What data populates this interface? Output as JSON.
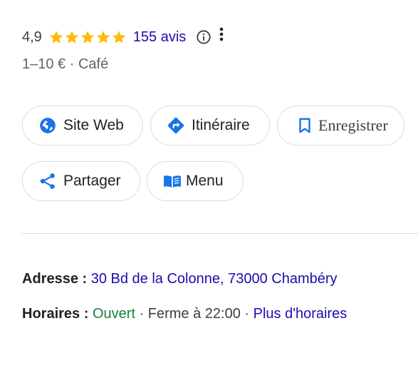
{
  "rating": {
    "value": "4,9",
    "stars_filled": 5,
    "star_color": "#fbbc04",
    "reviews_label": "155 avis"
  },
  "meta": {
    "text": "1–10 € · Café"
  },
  "actions": [
    {
      "label": "Site Web",
      "icon": "globe-icon"
    },
    {
      "label": "Itinéraire",
      "icon": "directions-icon"
    },
    {
      "label": "Enregistrer",
      "icon": "bookmark-icon"
    },
    {
      "label": "Partager",
      "icon": "share-icon"
    },
    {
      "label": "Menu",
      "icon": "menu-book-icon"
    }
  ],
  "address": {
    "label": "Adresse : ",
    "value": "30 Bd de la Colonne, 73000 Chambéry"
  },
  "hours": {
    "label": "Horaires : ",
    "status": "Ouvert",
    "separator1": " · ",
    "closing": "Ferme à 22:00",
    "separator2": " · ",
    "more_link": "Plus d'horaires"
  },
  "colors": {
    "accent_blue": "#1a73e8",
    "link": "#1a0dab",
    "open_green": "#188038",
    "star": "#fbbc04"
  }
}
